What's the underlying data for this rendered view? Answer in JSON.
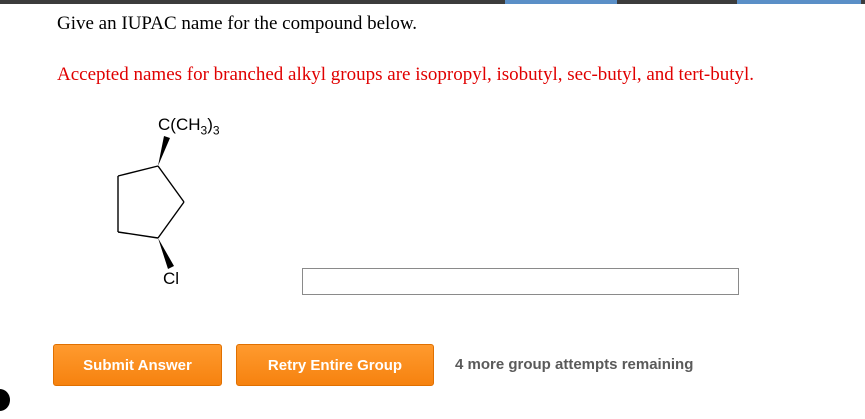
{
  "question": {
    "prompt": "Give an IUPAC name for the compound below.",
    "note": "Accepted names for branched alkyl groups are isopropyl, isobutyl, sec-butyl, and tert-butyl."
  },
  "molecule": {
    "top_substituent": "C(CH3)3",
    "bottom_substituent": "Cl"
  },
  "answer": {
    "value": "",
    "placeholder": ""
  },
  "actions": {
    "submit_label": "Submit Answer",
    "retry_label": "Retry Entire Group",
    "attempts_text": "4 more group attempts remaining"
  },
  "colors": {
    "note_red": "#e00000",
    "button_orange": "#f6820f",
    "attempts_gray": "#5a5a5a"
  }
}
